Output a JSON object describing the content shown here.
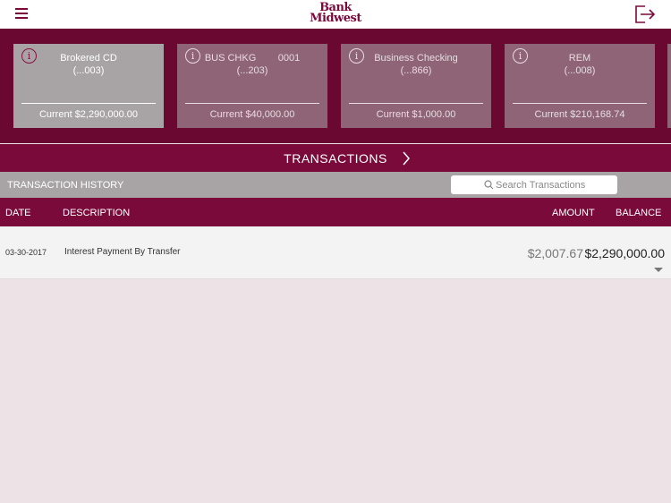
{
  "header": {
    "logo_line1": "Bank",
    "logo_line2": "Midwest"
  },
  "accounts": [
    {
      "name": "Brokered CD",
      "number": "(...003)",
      "balance": "Current $2,290,000.00",
      "selected": true
    },
    {
      "name": "BUS CHKG        0001",
      "number": "(...203)",
      "balance": "Current $40,000.00",
      "selected": false
    },
    {
      "name": "Business Checking",
      "number": "(...866)",
      "balance": "Current $1,000.00",
      "selected": false
    },
    {
      "name": "REM",
      "number": "(...008)",
      "balance": "Current $210,168.74",
      "selected": false
    }
  ],
  "transactions_bar": {
    "label": "TRANSACTIONS"
  },
  "history": {
    "title": "TRANSACTION HISTORY",
    "search_placeholder": "Search Transactions"
  },
  "columns": {
    "date": "DATE",
    "description": "DESCRIPTION",
    "amount": "AMOUNT",
    "balance": "BALANCE"
  },
  "rows": [
    {
      "date": "03-30-2017",
      "description": "Interest Payment By Transfer",
      "amount": "$2,007.67",
      "balance": "$2,290,000.00"
    }
  ],
  "colors": {
    "brand": "#7a0a3a",
    "card_selected": "#a8a4a6",
    "card": "#8f6476",
    "background": "#ede2e6"
  },
  "icons": {
    "menu": "hamburger-icon",
    "logout": "logout-icon",
    "info": "info-icon",
    "next": "chevron-right-icon",
    "search": "search-icon",
    "expand": "caret-down-icon"
  }
}
